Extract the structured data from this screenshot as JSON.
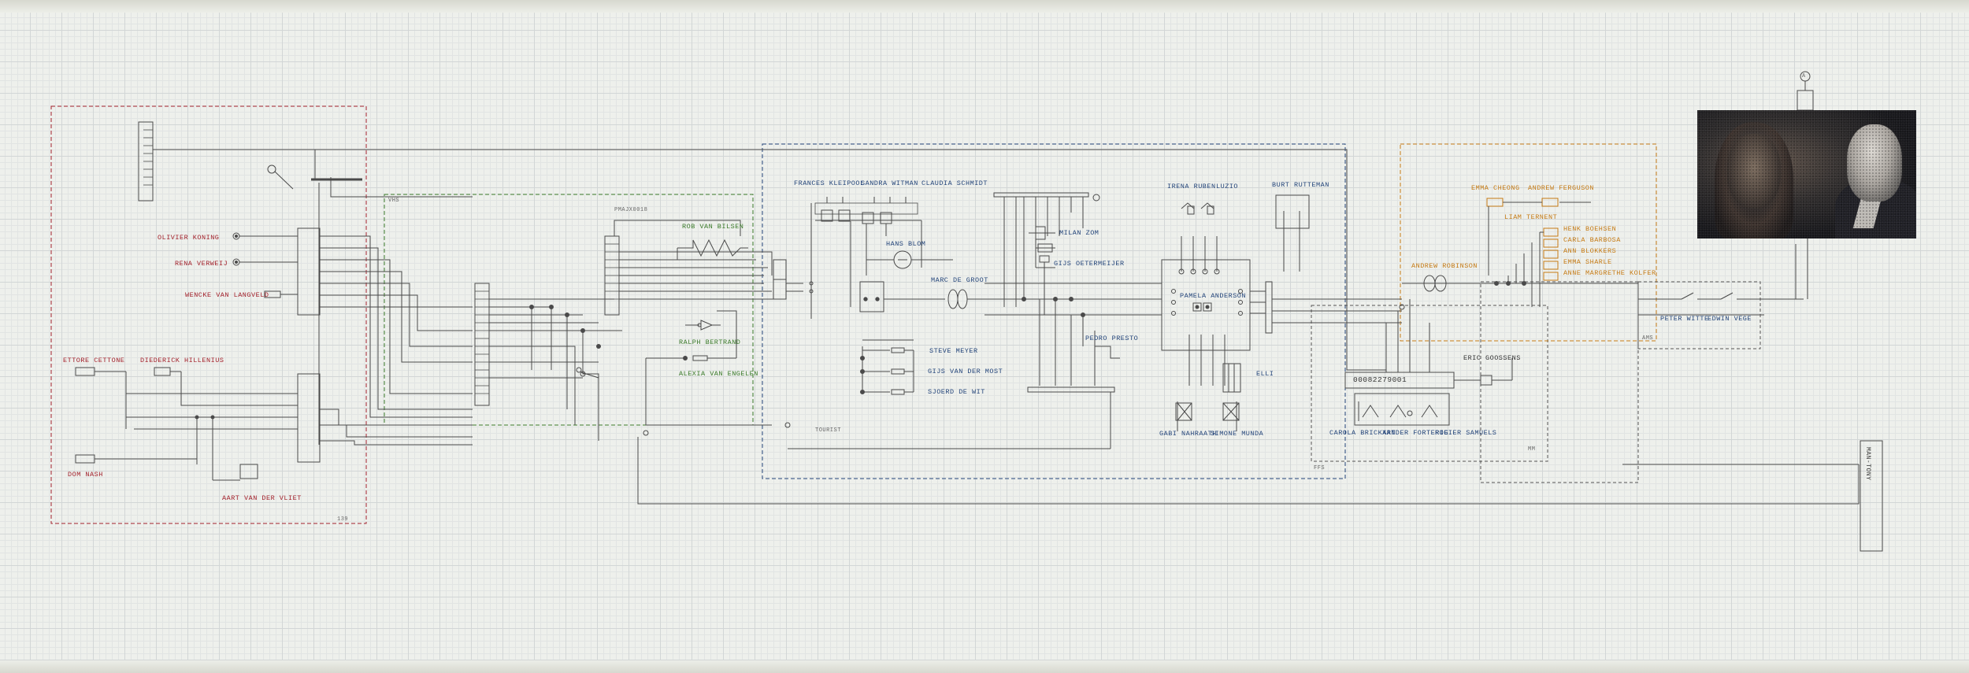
{
  "labels": {
    "olivier": "OLIVIER KONING",
    "rena": "RENA VERWEIJ",
    "wencke": "WENCKE VAN LANGVELD",
    "ettore": "ETTORE CETTONE",
    "diederick": "DIEDERICK HILLENIUS",
    "dom": "DOM NASH",
    "aart": "AART VAN DER VLIET",
    "group1_code": "IDEAS",
    "group1_num": "139",
    "group2_code": "VHS",
    "group3_code": "PMAJX0018",
    "rob": "ROB VAN BILSEN",
    "ralph": "RALPH BERTRAND",
    "alexia": "ALEXIA VAN ENGELEN",
    "frances": "FRANCES KLEIPOOL",
    "sandra": "SANDRA WITMAN",
    "claudia": "CLAUDIA SCHMIDT",
    "hans": "HANS BLOM",
    "marc": "MARC DE GROOT",
    "steve": "STEVE MEYER",
    "gijs": "GIJS VAN DER MOST",
    "sjoerd": "SJOERD DE WIT",
    "milan": "MILAN ZOM",
    "gijs_oo": "GIJS OETERMEIJER",
    "pedro": "PEDRO PRESTO",
    "group4_code": "TOURIST",
    "irena": "IRENA RUBEN",
    "luzio": "LUZIO",
    "burt": "BURT RUTTEMAN",
    "pamela": "PAMELA ANDERSON",
    "elli": "ELLI",
    "gabi": "GABI NAHRAATH",
    "simone": "SIMONE MUNDA",
    "group5_code": "FFS",
    "chip": "00082279001",
    "eric": "ERIC GOOSSENS",
    "carola": "CAROLA BRICKART",
    "xander": "XANDER FORTERIE",
    "rogier": "ROGIER SAMUELS",
    "mm": "MM",
    "emma": "EMMA CHEONG",
    "andrew_f": "ANDREW FERGUSON",
    "liam": "LIAM TERNENT",
    "henk": "HENK BOEHSEN",
    "carla": "CARLA BARBOSA",
    "ann": "ANN BLOKKERS",
    "emmash": "EMMA SHARLE",
    "anne": "ANNE MARGRETHE KOLFER",
    "andrew_r": "ANDREW ROBINSON",
    "peter": "PETER WITTE",
    "edwin": "EDWIN VEGE",
    "group6_code": "AMS",
    "output_label": "MAN-TONY",
    "pin_a": "A",
    "chip_a": "A",
    "chip_b": "B",
    "chip_c": "C"
  },
  "colors": {
    "red": "#a3212b",
    "blue": "#24457a",
    "green": "#3b7a2a",
    "orange": "#c57a14",
    "wire": "#4a4a4a"
  }
}
